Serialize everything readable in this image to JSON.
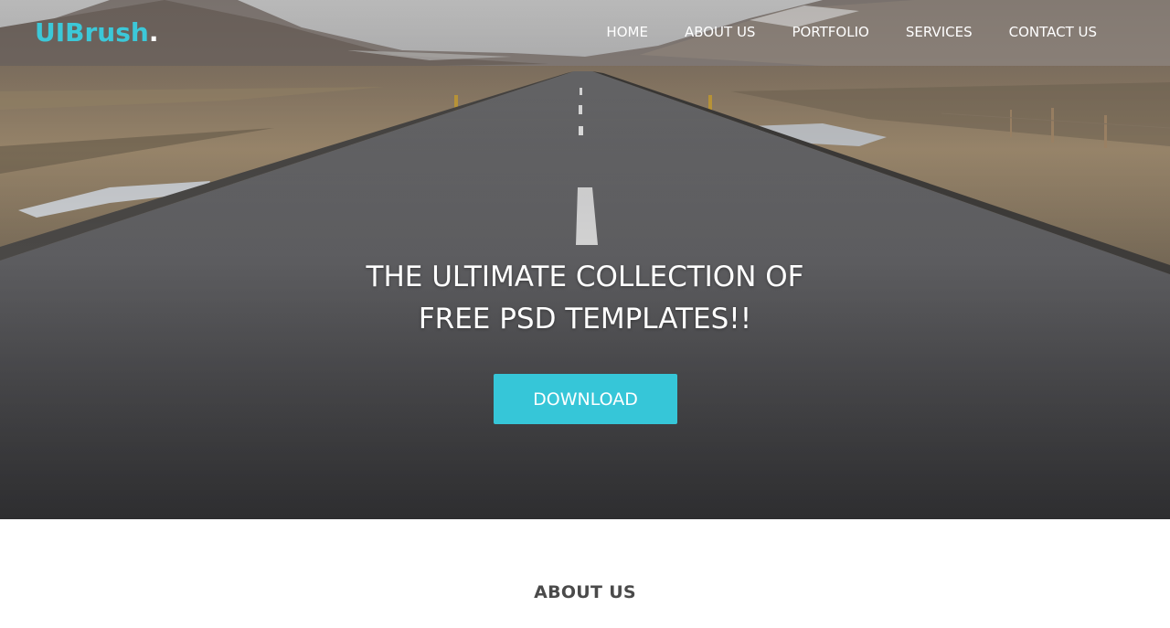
{
  "logo": {
    "text": "UIBrush",
    "dot": "."
  },
  "nav": {
    "items": [
      {
        "label": "HOME"
      },
      {
        "label": "ABOUT US"
      },
      {
        "label": "PORTFOLIO"
      },
      {
        "label": "SERVICES"
      },
      {
        "label": "CONTACT US"
      }
    ]
  },
  "hero": {
    "headline_line1": "THE ULTIMATE COLLECTION OF",
    "headline_line2": "FREE PSD TEMPLATES!!",
    "button_label": "DOWNLOAD",
    "background": "road-landscape-photo"
  },
  "about": {
    "title": "ABOUT US"
  },
  "colors": {
    "accent": "#36c6d8",
    "logo_accent": "#3cc8d8",
    "nav_text": "#ffffff",
    "body_bg": "#ffffff",
    "section_title": "#4a4a4a"
  }
}
